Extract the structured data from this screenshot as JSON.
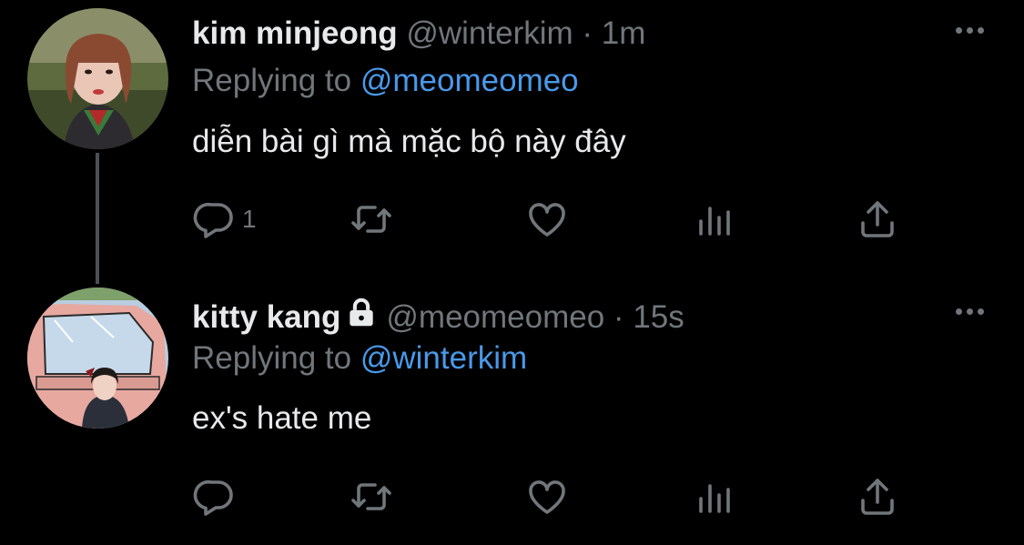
{
  "tweets": [
    {
      "name": "kim minjeong",
      "handle": "@winterkim",
      "separator": "·",
      "time": "1m",
      "replying_prefix": "Replying to",
      "replying_to": "@meomeomeo",
      "text": "diễn bài gì mà mặc bộ này đây",
      "reply_count": "1",
      "locked": false
    },
    {
      "name": "kitty kang",
      "handle": "@meomeomeo",
      "separator": "·",
      "time": "15s",
      "replying_prefix": "Replying to",
      "replying_to": "@winterkim",
      "text": "ex's hate me",
      "reply_count": "",
      "locked": true
    }
  ],
  "icons": {
    "reply": "reply-icon",
    "retweet": "retweet-icon",
    "like": "heart-icon",
    "analytics": "analytics-icon",
    "share": "share-icon",
    "more": "more-icon",
    "lock": "lock-icon"
  },
  "colors": {
    "background": "#000000",
    "text": "#e7e9ea",
    "secondary": "#71767b",
    "mention": "#4a99e9",
    "thread_line": "#4c5055"
  }
}
